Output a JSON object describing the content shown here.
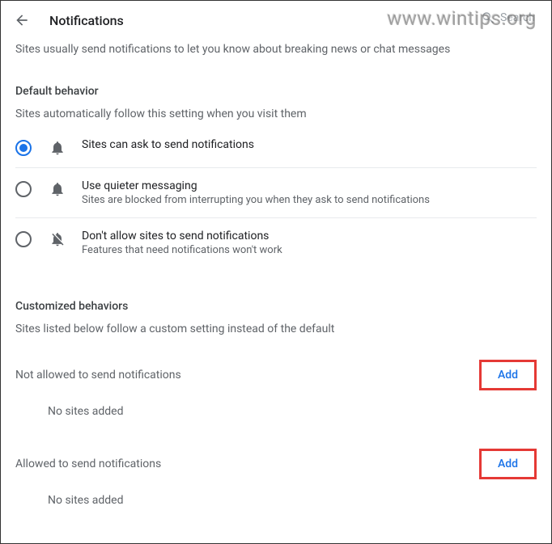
{
  "header": {
    "title": "Notifications",
    "search_placeholder": "Search"
  },
  "watermark": "www.wintips.org",
  "intro": "Sites usually send notifications to let you know about breaking news or chat messages",
  "default_section": {
    "title": "Default behavior",
    "subtitle": "Sites automatically follow this setting when you visit them",
    "options": [
      {
        "label": "Sites can ask to send notifications",
        "desc": ""
      },
      {
        "label": "Use quieter messaging",
        "desc": "Sites are blocked from interrupting you when they ask to send notifications"
      },
      {
        "label": "Don't allow sites to send notifications",
        "desc": "Features that need notifications won't work"
      }
    ]
  },
  "custom_section": {
    "title": "Customized behaviors",
    "subtitle": "Sites listed below follow a custom setting instead of the default",
    "not_allowed_label": "Not allowed to send notifications",
    "allowed_label": "Allowed to send notifications",
    "add_label": "Add",
    "empty_label": "No sites added"
  }
}
